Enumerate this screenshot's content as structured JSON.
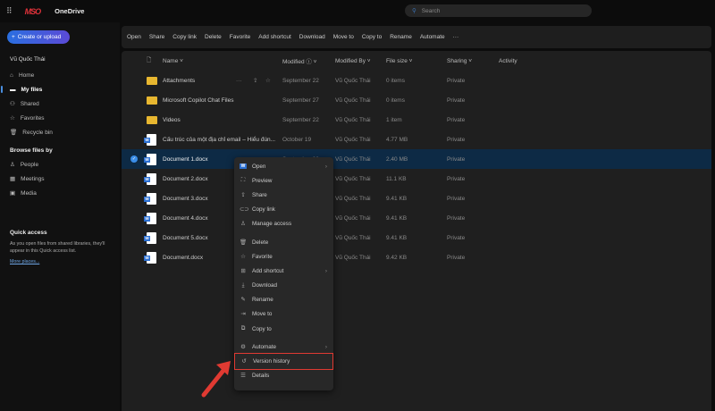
{
  "app": {
    "logo": "MSO",
    "name": "OneDrive",
    "search_placeholder": "Search"
  },
  "sidebar": {
    "create_label": "Create or upload",
    "user": "Vũ Quốc Thái",
    "items": [
      {
        "label": "Home",
        "icon": "home-icon"
      },
      {
        "label": "My files",
        "icon": "folder-icon",
        "active": true
      },
      {
        "label": "Shared",
        "icon": "people-icon"
      },
      {
        "label": "Favorites",
        "icon": "star-icon"
      },
      {
        "label": "Recycle bin",
        "icon": "trash-icon"
      }
    ],
    "browse_title": "Browse files by",
    "browse": [
      {
        "label": "People",
        "icon": "person-icon"
      },
      {
        "label": "Meetings",
        "icon": "calendar-icon"
      },
      {
        "label": "Media",
        "icon": "image-icon"
      }
    ],
    "quick_title": "Quick access",
    "quick_text": "As you open files from shared libraries, they'll appear in this Quick access list.",
    "more_places": "More places..."
  },
  "toolbar": [
    "Open",
    "Share",
    "Copy link",
    "Delete",
    "Favorite",
    "Add shortcut",
    "Download",
    "Move to",
    "Copy to",
    "Rename",
    "Automate",
    "···"
  ],
  "columns": {
    "name": "Name ˅",
    "modified": "Modified ⓘ ˅",
    "modified_by": "Modified By ˅",
    "size": "File size ˅",
    "sharing": "Sharing ˅",
    "activity": "Activity"
  },
  "files": [
    {
      "name": "Attachments",
      "type": "folder",
      "modified": "September 22",
      "by": "Vũ Quốc Thái",
      "size": "0 items",
      "sharing": "Private"
    },
    {
      "name": "Microsoft Copilot Chat Files",
      "type": "folder",
      "modified": "September 27",
      "by": "Vũ Quốc Thái",
      "size": "0 items",
      "sharing": "Private"
    },
    {
      "name": "Videos",
      "type": "folder",
      "modified": "September 22",
      "by": "Vũ Quốc Thái",
      "size": "1 item",
      "sharing": "Private"
    },
    {
      "name": "Cấu trúc của một địa chỉ email – Hiểu đún...",
      "type": "docx",
      "modified": "October 19",
      "by": "Vũ Quốc Thái",
      "size": "4.77 MB",
      "sharing": "Private"
    },
    {
      "name": "Document 1.docx",
      "type": "docx",
      "modified": "September 22",
      "by": "Vũ Quốc Thái",
      "size": "2.40 MB",
      "sharing": "Private",
      "selected": true
    },
    {
      "name": "Document 2.docx",
      "type": "docx",
      "modified": "",
      "by": "Vũ Quốc Thái",
      "size": "11.1 KB",
      "sharing": "Private"
    },
    {
      "name": "Document 3.docx",
      "type": "docx",
      "modified": "",
      "by": "Vũ Quốc Thái",
      "size": "9.41 KB",
      "sharing": "Private"
    },
    {
      "name": "Document 4.docx",
      "type": "docx",
      "modified": "",
      "by": "Vũ Quốc Thái",
      "size": "9.41 KB",
      "sharing": "Private"
    },
    {
      "name": "Document 5.docx",
      "type": "docx",
      "modified": "",
      "by": "Vũ Quốc Thái",
      "size": "9.41 KB",
      "sharing": "Private"
    },
    {
      "name": "Document.docx",
      "type": "docx",
      "modified": "",
      "by": "Vũ Quốc Thái",
      "size": "9.42 KB",
      "sharing": "Private"
    }
  ],
  "context_menu": [
    {
      "label": "Open",
      "icon": "word-icon",
      "submenu": true
    },
    {
      "label": "Preview",
      "icon": "preview-icon"
    },
    {
      "label": "Share",
      "icon": "share-icon"
    },
    {
      "label": "Copy link",
      "icon": "link-icon"
    },
    {
      "label": "Manage access",
      "icon": "person-icon"
    },
    {
      "divider": true
    },
    {
      "label": "Delete",
      "icon": "trash-icon"
    },
    {
      "label": "Favorite",
      "icon": "star-icon"
    },
    {
      "label": "Add shortcut",
      "icon": "shortcut-icon",
      "submenu": true
    },
    {
      "label": "Download",
      "icon": "download-icon"
    },
    {
      "label": "Rename",
      "icon": "rename-icon"
    },
    {
      "label": "Move to",
      "icon": "move-icon"
    },
    {
      "label": "Copy to",
      "icon": "copy-icon"
    },
    {
      "divider": true
    },
    {
      "label": "Automate",
      "icon": "automate-icon",
      "submenu": true
    },
    {
      "label": "Version history",
      "icon": "history-icon",
      "highlighted": true
    },
    {
      "label": "Details",
      "icon": "details-icon"
    }
  ],
  "colors": {
    "accent": "#3a8de8",
    "highlight_box": "#e03a32",
    "selected_row": "#0d2a45"
  }
}
